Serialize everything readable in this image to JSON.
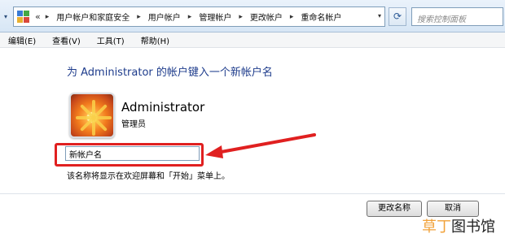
{
  "address_bar": {
    "lead": "«",
    "breadcrumbs": [
      "用户帐户和家庭安全",
      "用户帐户",
      "管理帐户",
      "更改帐户",
      "重命名帐户"
    ],
    "search_placeholder": "搜索控制面板"
  },
  "menu": [
    "编辑(E)",
    "查看(V)",
    "工具(T)",
    "帮助(H)"
  ],
  "main": {
    "title": "为 Administrator 的帐户键入一个新帐户名",
    "account_name": "Administrator",
    "account_role": "管理员",
    "new_name_value": "新帐户名",
    "hint": "该名称将显示在欢迎屏幕和「开始」菜单上。"
  },
  "buttons": {
    "rename": "更改名称",
    "cancel": "取消"
  },
  "watermark": {
    "first": "草丁",
    "rest": "图书馆"
  },
  "colors": {
    "title_blue": "#1e3c8c",
    "highlight_red": "#e02020",
    "watermark_orange": "#f1a23a"
  }
}
